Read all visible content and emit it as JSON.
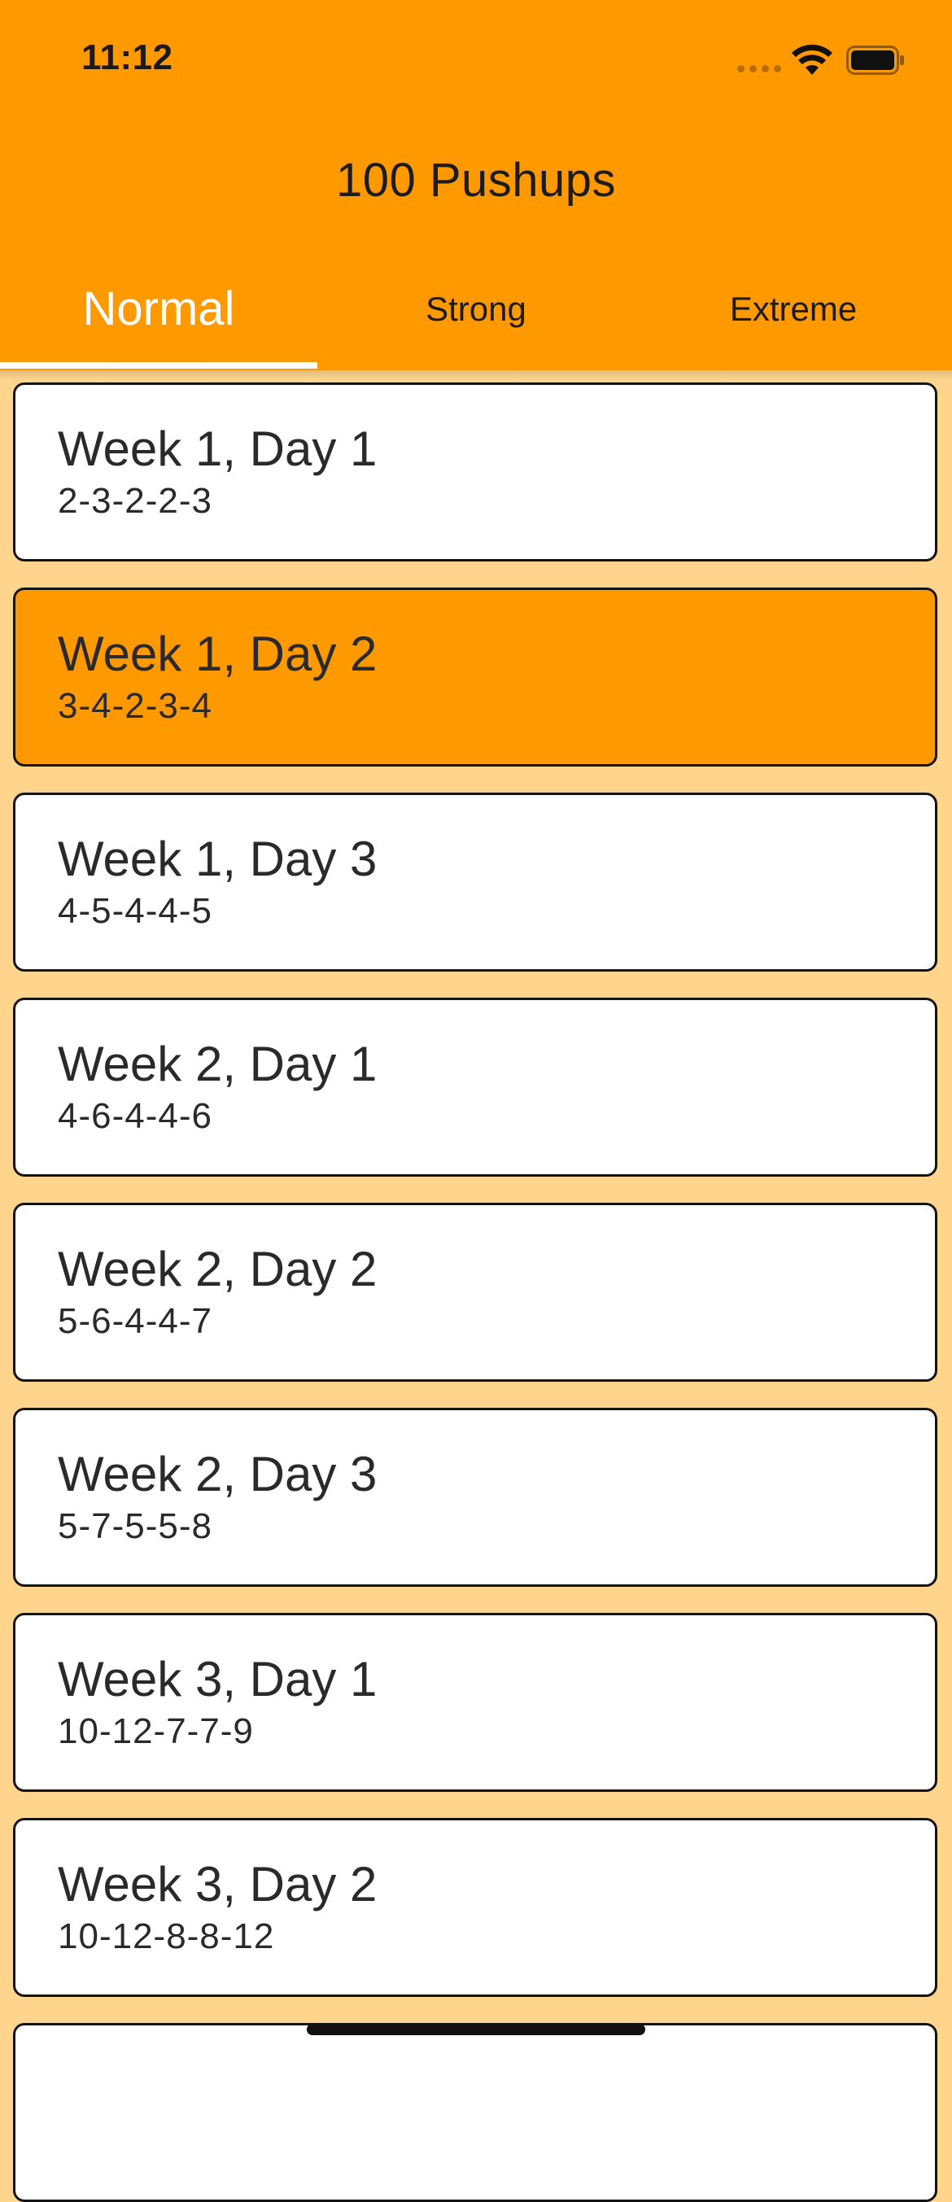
{
  "status_bar": {
    "time": "11:12"
  },
  "header": {
    "title": "100 Pushups",
    "tabs": [
      {
        "label": "Normal",
        "active": true
      },
      {
        "label": "Strong",
        "active": false
      },
      {
        "label": "Extreme",
        "active": false
      }
    ]
  },
  "workouts": [
    {
      "title": "Week 1, Day 1",
      "sets": "2-3-2-2-3",
      "selected": false
    },
    {
      "title": "Week 1, Day 2",
      "sets": "3-4-2-3-4",
      "selected": true
    },
    {
      "title": "Week 1, Day 3",
      "sets": "4-5-4-4-5",
      "selected": false
    },
    {
      "title": "Week 2, Day 1",
      "sets": "4-6-4-4-6",
      "selected": false
    },
    {
      "title": "Week 2, Day 2",
      "sets": "5-6-4-4-7",
      "selected": false
    },
    {
      "title": "Week 2, Day 3",
      "sets": "5-7-5-5-8",
      "selected": false
    },
    {
      "title": "Week 3, Day 1",
      "sets": "10-12-7-7-9",
      "selected": false
    },
    {
      "title": "Week 3, Day 2",
      "sets": "10-12-8-8-12",
      "selected": false
    },
    {
      "title": "",
      "sets": "",
      "selected": false
    }
  ],
  "colors": {
    "primary": "#FF9900",
    "background": "#FFD58E",
    "card": "#FFFFFF",
    "active_tab_text": "#FFFFFF"
  },
  "icons": [
    "cellular-signal-icon",
    "wifi-icon",
    "battery-icon"
  ]
}
